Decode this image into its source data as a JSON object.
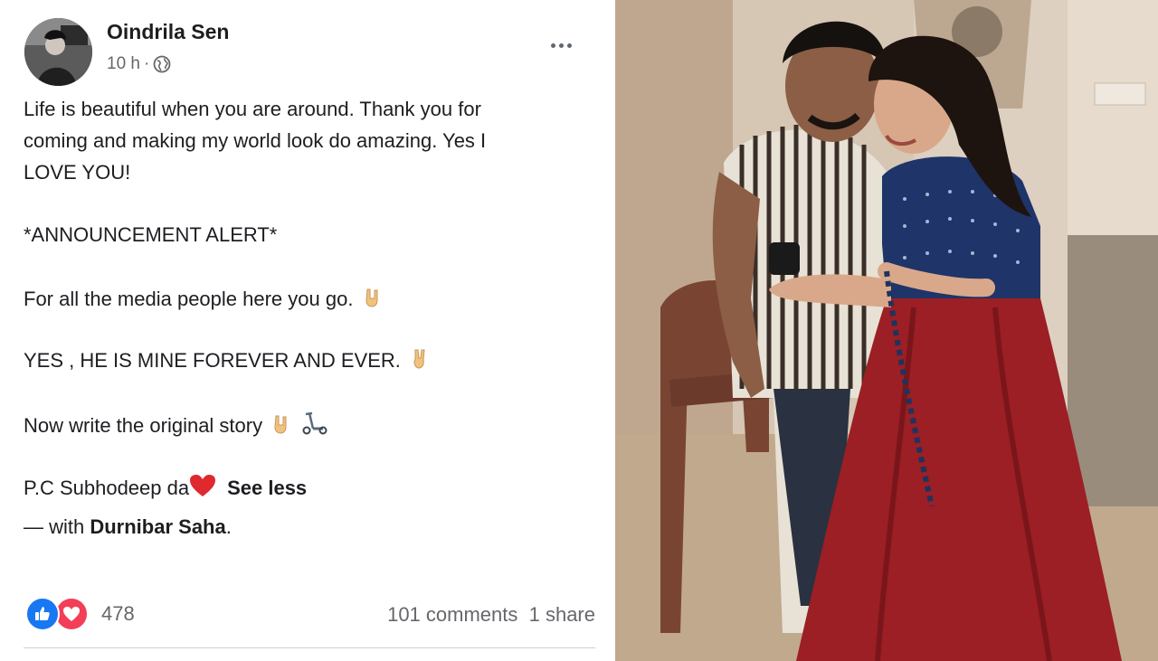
{
  "post": {
    "author": "Oindrila Sen",
    "time": "10 h",
    "separator": "·",
    "privacy_icon": "globe-icon",
    "more_icon": "more-options-icon",
    "body": {
      "line1": "Life is beautiful when you are around. Thank you for",
      "line2": "coming and making my world look do amazing. Yes I",
      "line3": "LOVE YOU!",
      "announcement": "*ANNOUNCEMENT ALERT*",
      "media": "For all the media people here you go.",
      "mine": "YES , HE IS MINE FOREVER AND EVER.",
      "story": "Now write the original story",
      "pc": "P.C Subhodeep da",
      "see_less": "See less",
      "with_prefix": "— with ",
      "with_name": "Durnibar Saha",
      "with_suffix": "."
    },
    "reactions": {
      "icons": [
        "like-icon",
        "love-icon"
      ],
      "count": "478"
    },
    "comments": "101 comments",
    "shares": "1 share"
  },
  "colors": {
    "like_blue": "#1877f2",
    "love_red": "#f33e58",
    "text": "#1c1e21",
    "muted": "#65676b"
  }
}
